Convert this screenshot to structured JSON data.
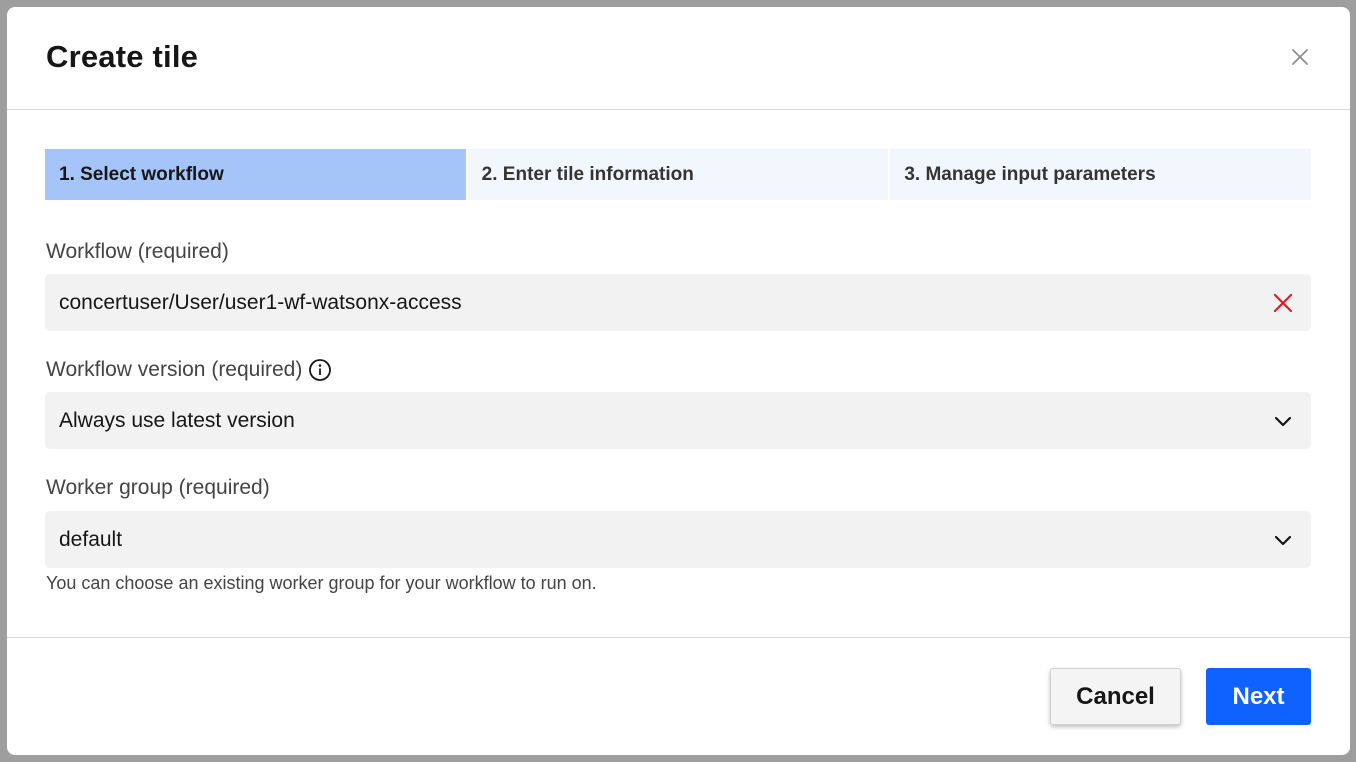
{
  "dialog": {
    "title": "Create tile"
  },
  "steps": [
    {
      "label": "1. Select workflow",
      "active": true
    },
    {
      "label": "2. Enter tile information",
      "active": false
    },
    {
      "label": "3. Manage input parameters",
      "active": false
    }
  ],
  "workflow": {
    "label": "Workflow (required)",
    "value": "concertuser/User/user1-wf-watsonx-access",
    "clear_icon": "close-icon",
    "clear_color": "#da1e28"
  },
  "workflow_version": {
    "label": "Workflow version (required)",
    "value": "Always use latest version",
    "info_icon": "info-icon",
    "dropdown_icon": "chevron-down-icon"
  },
  "worker_group": {
    "label": "Worker group (required)",
    "value": "default",
    "helper_text": "You can choose an existing worker group for your workflow to run on.",
    "dropdown_icon": "chevron-down-icon"
  },
  "footer": {
    "cancel_label": "Cancel",
    "next_label": "Next"
  },
  "colors": {
    "primary": "#0f62fe",
    "active_step": "#a5c4f7",
    "inactive_step": "#f2f7fe",
    "field_bg": "#f2f2f2"
  }
}
